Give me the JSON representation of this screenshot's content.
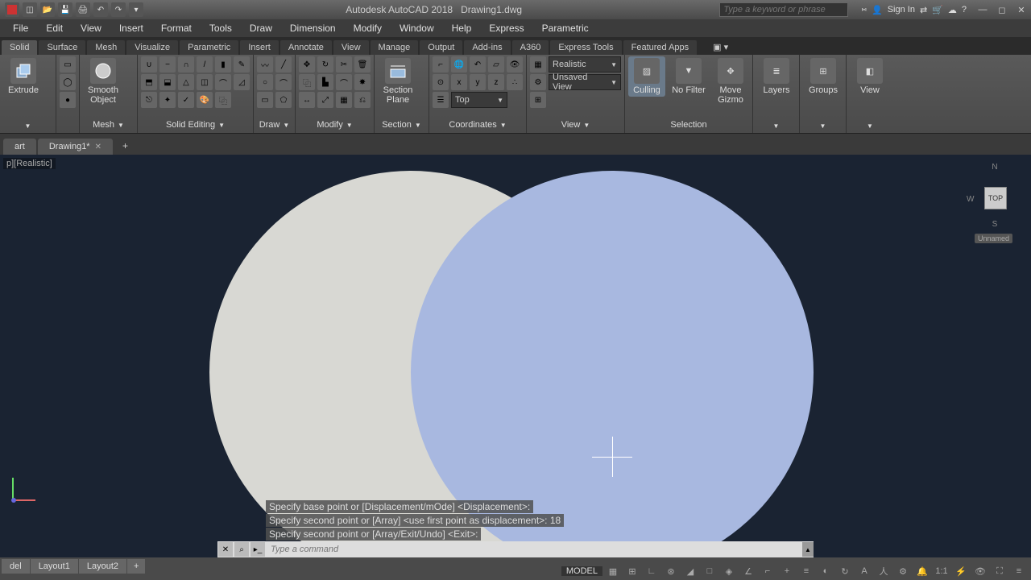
{
  "titlebar": {
    "app": "Autodesk AutoCAD 2018",
    "doc": "Drawing1.dwg",
    "search_placeholder": "Type a keyword or phrase",
    "signin": "Sign In"
  },
  "menus": [
    "File",
    "Edit",
    "View",
    "Insert",
    "Format",
    "Tools",
    "Draw",
    "Dimension",
    "Modify",
    "Window",
    "Help",
    "Express",
    "Parametric"
  ],
  "ribtabs": [
    "Solid",
    "Surface",
    "Mesh",
    "Visualize",
    "Parametric",
    "Insert",
    "Annotate",
    "View",
    "Manage",
    "Output",
    "Add-ins",
    "A360",
    "Express Tools",
    "Featured Apps"
  ],
  "panels": {
    "extrude": "Extrude",
    "smooth": "Smooth Object",
    "mesh": "Mesh",
    "solidediting": "Solid Editing",
    "draw": "Draw",
    "modify": "Modify",
    "sectionplane": "Section Plane",
    "section": "Section",
    "coordinates": "Coordinates",
    "viewpanel": "View",
    "selection": "Selection",
    "culling": "Culling",
    "nofilter": "No Filter",
    "movegizmo": "Move Gizmo",
    "layers": "Layers",
    "groups": "Groups",
    "view": "View",
    "visual_style": "Realistic",
    "unsaved_view": "Unsaved View",
    "top": "Top"
  },
  "filetabs": {
    "start": "art",
    "drawing": "Drawing1*"
  },
  "viewport": {
    "label": "p][Realistic]"
  },
  "viewcube": {
    "n": "N",
    "s": "S",
    "w": "W",
    "face": "TOP",
    "unnamed": "Unnamed"
  },
  "cmd_history": [
    "Specify base point or [Displacement/mOde] <Displacement>:",
    "Specify second point or [Array] <use first point as displacement>: 18",
    "Specify second point or [Array/Exit/Undo] <Exit>:"
  ],
  "cmdline_placeholder": "Type a command",
  "layouts": [
    "del",
    "Layout1",
    "Layout2"
  ],
  "statusbar": {
    "model": "MODEL"
  }
}
